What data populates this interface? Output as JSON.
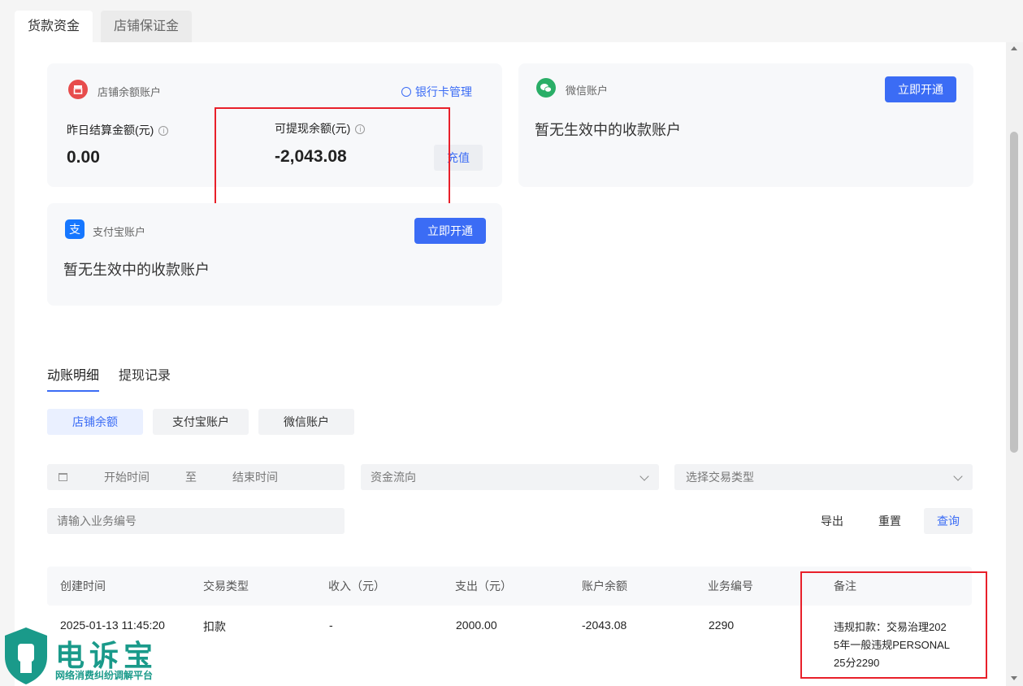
{
  "top_tabs": [
    {
      "label": "货款资金",
      "active": true
    },
    {
      "label": "店铺保证金",
      "active": false
    }
  ],
  "store_card": {
    "title": "店铺余额账户",
    "bank_link": "银行卡管理",
    "yesterday_label": "昨日结算金额(元)",
    "yesterday_value": "0.00",
    "withdrawable_label": "可提现余额(元)",
    "withdrawable_value": "-2,043.08",
    "recharge_label": "充值"
  },
  "wechat_card": {
    "title": "微信账户",
    "open_label": "立即开通",
    "empty_text": "暂无生效中的收款账户"
  },
  "alipay_card": {
    "title": "支付宝账户",
    "open_label": "立即开通",
    "empty_text": "暂无生效中的收款账户"
  },
  "sub_tabs": [
    {
      "label": "动账明细",
      "active": true
    },
    {
      "label": "提现记录",
      "active": false
    }
  ],
  "account_filters": [
    {
      "label": "店铺余额",
      "active": true
    },
    {
      "label": "支付宝账户",
      "active": false
    },
    {
      "label": "微信账户",
      "active": false
    }
  ],
  "filters": {
    "start_placeholder": "开始时间",
    "to_label": "至",
    "end_placeholder": "结束时间",
    "flow_placeholder": "资金流向",
    "type_placeholder": "选择交易类型",
    "business_no_placeholder": "请输入业务编号"
  },
  "actions": {
    "export": "导出",
    "reset": "重置",
    "query": "查询"
  },
  "table": {
    "headers": [
      "创建时间",
      "交易类型",
      "收入（元）",
      "支出（元）",
      "账户余额",
      "业务编号",
      "备注"
    ],
    "rows": [
      {
        "created": "2025-01-13 11:45:20",
        "type": "扣款",
        "income": "-",
        "expense": "2000.00",
        "balance": "-2043.08",
        "business_no": "2290",
        "remark_lines": [
          "违规扣款：交易治理202",
          "5年一般违规PERSONAL",
          "25分2290"
        ]
      }
    ]
  },
  "watermark": {
    "title": "电诉宝",
    "subtitle": "网络消费纠纷调解平台"
  },
  "colors": {
    "accent": "#3b6cf5",
    "highlight_box": "#e8202a",
    "wechat": "#2aae67",
    "alipay": "#1677ff",
    "store": "#e74c4c"
  }
}
